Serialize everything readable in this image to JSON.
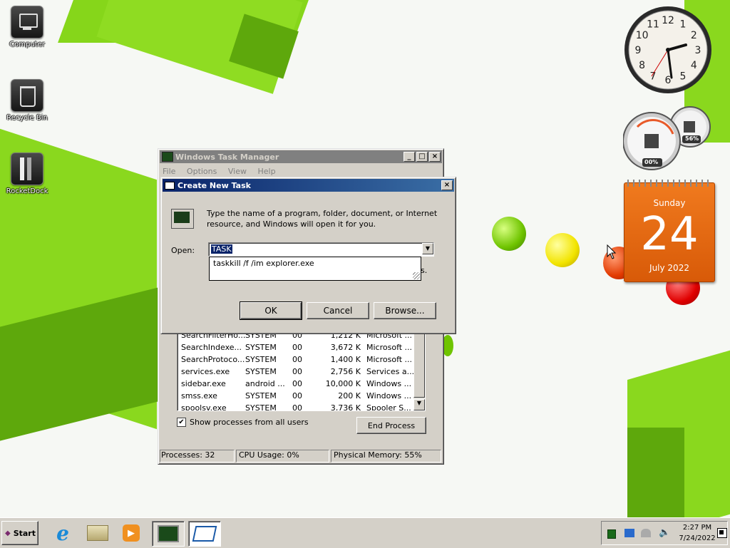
{
  "desktop_icons": [
    {
      "label": "Computer",
      "icon": "computer-icon"
    },
    {
      "label": "Recycle Bin",
      "icon": "recycle-bin-icon"
    },
    {
      "label": "RocketDock",
      "icon": "rocketdock-icon"
    }
  ],
  "task_manager": {
    "title": "Windows Task Manager",
    "menu": [
      "File",
      "Options",
      "View",
      "Help"
    ],
    "processes": [
      {
        "name": "SearchFilterHo...",
        "user": "SYSTEM",
        "cpu": "00",
        "mem": "1,212 K",
        "desc": "Microsoft ..."
      },
      {
        "name": "SearchIndexe...",
        "user": "SYSTEM",
        "cpu": "00",
        "mem": "3,672 K",
        "desc": "Microsoft ..."
      },
      {
        "name": "SearchProtoco...",
        "user": "SYSTEM",
        "cpu": "00",
        "mem": "1,400 K",
        "desc": "Microsoft ..."
      },
      {
        "name": "services.exe",
        "user": "SYSTEM",
        "cpu": "00",
        "mem": "2,756 K",
        "desc": "Services a..."
      },
      {
        "name": "sidebar.exe",
        "user": "android ...",
        "cpu": "00",
        "mem": "10,000 K",
        "desc": "Windows ..."
      },
      {
        "name": "smss.exe",
        "user": "SYSTEM",
        "cpu": "00",
        "mem": "200 K",
        "desc": "Windows ..."
      },
      {
        "name": "spoolsv.exe",
        "user": "SYSTEM",
        "cpu": "00",
        "mem": "3,736 K",
        "desc": "Spooler S..."
      }
    ],
    "show_all_label": "Show processes from all users",
    "show_all_checked": true,
    "end_process_label": "End Process",
    "status": {
      "processes": "Processes: 32",
      "cpu": "CPU Usage: 0%",
      "memory": "Physical Memory: 55%"
    }
  },
  "run_dialog": {
    "title": "Create New Task",
    "description": "Type the name of a program, folder, document, or Internet resource, and Windows will open it for you.",
    "open_label": "Open:",
    "open_value": "TASK",
    "autocomplete": [
      "taskkill /f /im explorer.exe"
    ],
    "partial_text": "s.",
    "ok_label": "OK",
    "cancel_label": "Cancel",
    "browse_label": "Browse..."
  },
  "gadgets": {
    "clock_numbers": [
      "12",
      "1",
      "2",
      "3",
      "4",
      "5",
      "6",
      "7",
      "8",
      "9",
      "10",
      "11"
    ],
    "cpu_meter": "00%",
    "mem_meter": "56%",
    "calendar": {
      "day_name": "Sunday",
      "day": "24",
      "month_year": "July 2022"
    }
  },
  "taskbar": {
    "start_label": "Start",
    "time": "2:27 PM",
    "date": "7/24/2022"
  },
  "colors": {
    "accent": "#0a246a",
    "lime": "#86d61a",
    "calendar": "#e8650a"
  }
}
